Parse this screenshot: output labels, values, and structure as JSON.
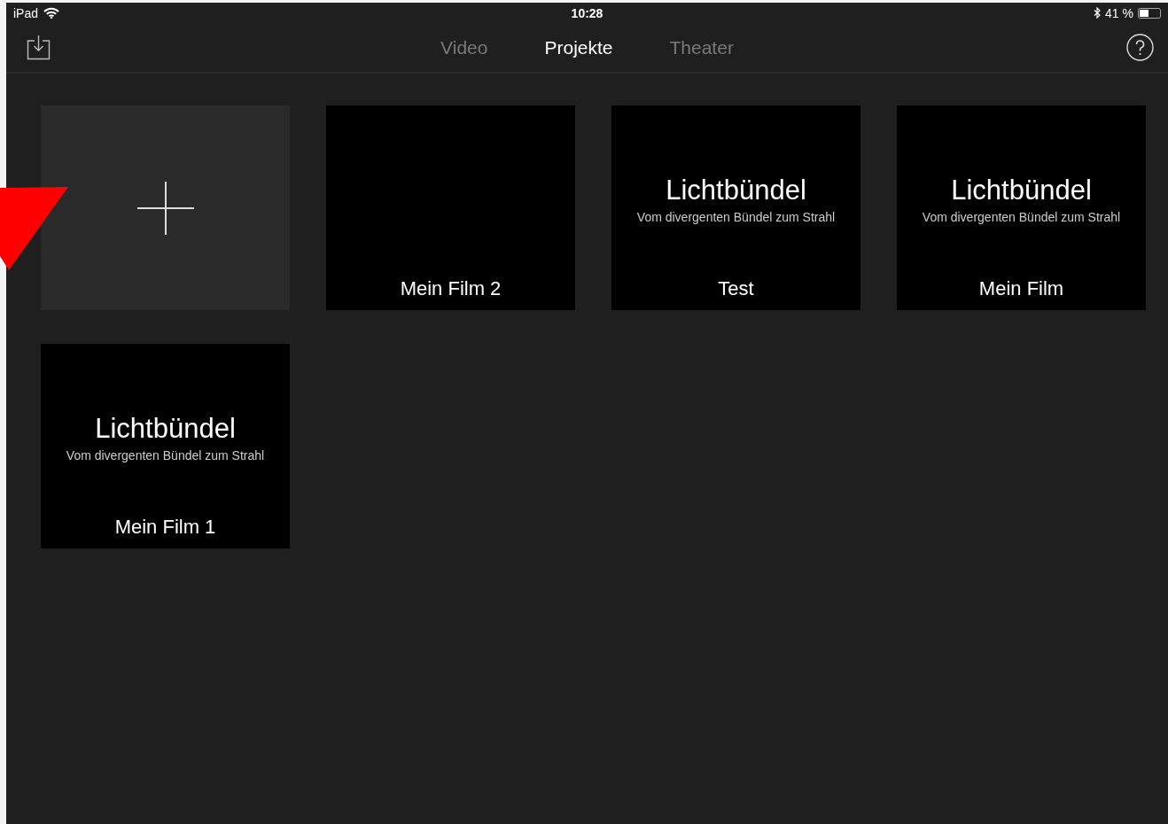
{
  "status_bar": {
    "device": "iPad",
    "time": "10:28",
    "battery": "41 %"
  },
  "nav": {
    "tabs": [
      {
        "label": "Video",
        "selected": false
      },
      {
        "label": "Projekte",
        "selected": true
      },
      {
        "label": "Theater",
        "selected": false
      }
    ]
  },
  "projects": [
    {
      "kind": "new"
    },
    {
      "kind": "project",
      "name": "Mein Film 2"
    },
    {
      "kind": "project",
      "title": "Lichtbündel",
      "subtitle": "Vom divergenten Bündel zum Strahl",
      "name": "Test"
    },
    {
      "kind": "project",
      "title": "Lichtbündel",
      "subtitle": "Vom divergenten Bündel zum Strahl",
      "name": "Mein Film"
    },
    {
      "kind": "project",
      "title": "Lichtbündel",
      "subtitle": "Vom divergenten Bündel zum Strahl",
      "name": "Mein Film 1"
    }
  ]
}
